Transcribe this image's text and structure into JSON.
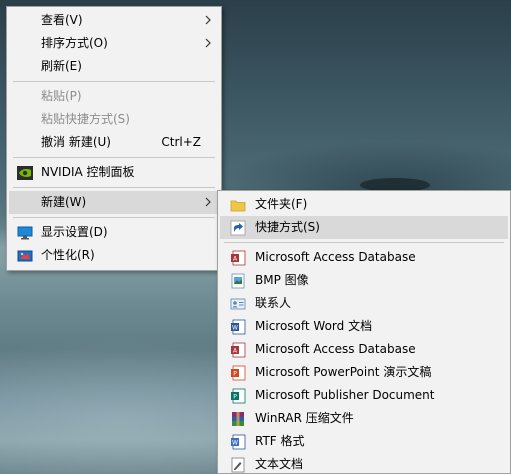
{
  "context_menu": {
    "items": [
      {
        "label": "查看(V)",
        "has_submenu": true,
        "enabled": true
      },
      {
        "label": "排序方式(O)",
        "has_submenu": true,
        "enabled": true
      },
      {
        "label": "刷新(E)",
        "enabled": true
      },
      {
        "label": "粘贴(P)",
        "enabled": false
      },
      {
        "label": "粘贴快捷方式(S)",
        "enabled": false
      },
      {
        "label": "撤消 新建(U)",
        "shortcut": "Ctrl+Z",
        "enabled": true
      },
      {
        "label": "NVIDIA 控制面板",
        "icon": "nvidia-icon",
        "enabled": true
      },
      {
        "label": "新建(W)",
        "has_submenu": true,
        "enabled": true,
        "highlighted": true
      },
      {
        "label": "显示设置(D)",
        "icon": "display-settings-icon",
        "enabled": true
      },
      {
        "label": "个性化(R)",
        "icon": "personalize-icon",
        "enabled": true
      }
    ]
  },
  "new_submenu": {
    "items": [
      {
        "label": "文件夹(F)",
        "icon": "folder-icon"
      },
      {
        "label": "快捷方式(S)",
        "icon": "shortcut-icon",
        "highlighted": true
      },
      {
        "label": "Microsoft Access Database",
        "icon": "access-icon"
      },
      {
        "label": "BMP 图像",
        "icon": "bmp-image-icon"
      },
      {
        "label": "联系人",
        "icon": "contact-icon"
      },
      {
        "label": "Microsoft Word 文档",
        "icon": "word-icon"
      },
      {
        "label": "Microsoft Access Database",
        "icon": "access-icon"
      },
      {
        "label": "Microsoft PowerPoint 演示文稿",
        "icon": "powerpoint-icon"
      },
      {
        "label": "Microsoft Publisher Document",
        "icon": "publisher-icon"
      },
      {
        "label": "WinRAR 压缩文件",
        "icon": "winrar-icon"
      },
      {
        "label": "RTF 格式",
        "icon": "rtf-icon"
      },
      {
        "label": "文本文档",
        "icon": "text-document-icon"
      }
    ]
  },
  "colors": {
    "menu_background": "#f2f2f2",
    "highlight": "#d9d9d9",
    "disabled_text": "#8d8d8d"
  }
}
